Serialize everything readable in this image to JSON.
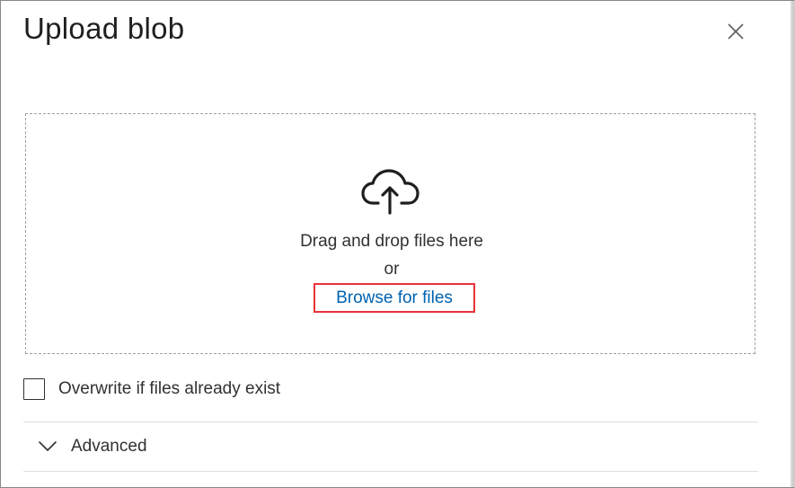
{
  "panel": {
    "title": "Upload blob",
    "close_icon": "close-icon"
  },
  "dropzone": {
    "icon": "cloud-upload-icon",
    "main_text": "Drag and drop files here",
    "or_text": "or",
    "browse_label": "Browse for files"
  },
  "overwrite": {
    "label": "Overwrite if files already exist",
    "checked": false
  },
  "advanced": {
    "label": "Advanced",
    "icon": "chevron-down-icon",
    "expanded": false
  },
  "colors": {
    "link": "#0063b1",
    "highlight_border": "#e8333a",
    "text": "#323130"
  }
}
